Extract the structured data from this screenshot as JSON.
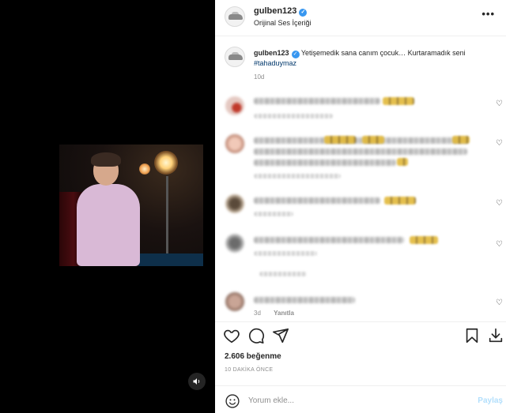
{
  "post": {
    "username": "gulben123",
    "audio_label": "Orijinal Ses İçeriği",
    "more_label": "•••"
  },
  "caption": {
    "username": "gulben123",
    "text": "Yetişemedik sana canım çocuk… Kurtaramadık seni",
    "hashtag": "#tahaduymaz",
    "time": "10d"
  },
  "last_comment": {
    "time": "3d",
    "reply_label": "Yanıtla"
  },
  "stats": {
    "likes": "2.606 beğenme",
    "posted_ago": "10 DAKİKA ÖNCE"
  },
  "comment_box": {
    "placeholder": "Yorum ekle...",
    "post_label": "Paylaş"
  },
  "icons": {
    "verified": "verified-badge-icon",
    "like": "heart-icon",
    "comment": "comment-icon",
    "share": "paper-plane-icon",
    "save": "bookmark-icon",
    "download": "download-icon",
    "emoji": "emoji-icon",
    "audio": "speaker-icon"
  },
  "colors": {
    "verified": "#3897f0",
    "hashtag": "#00376b",
    "post_button": "#b2dffc",
    "muted": "#8e8e8e"
  }
}
